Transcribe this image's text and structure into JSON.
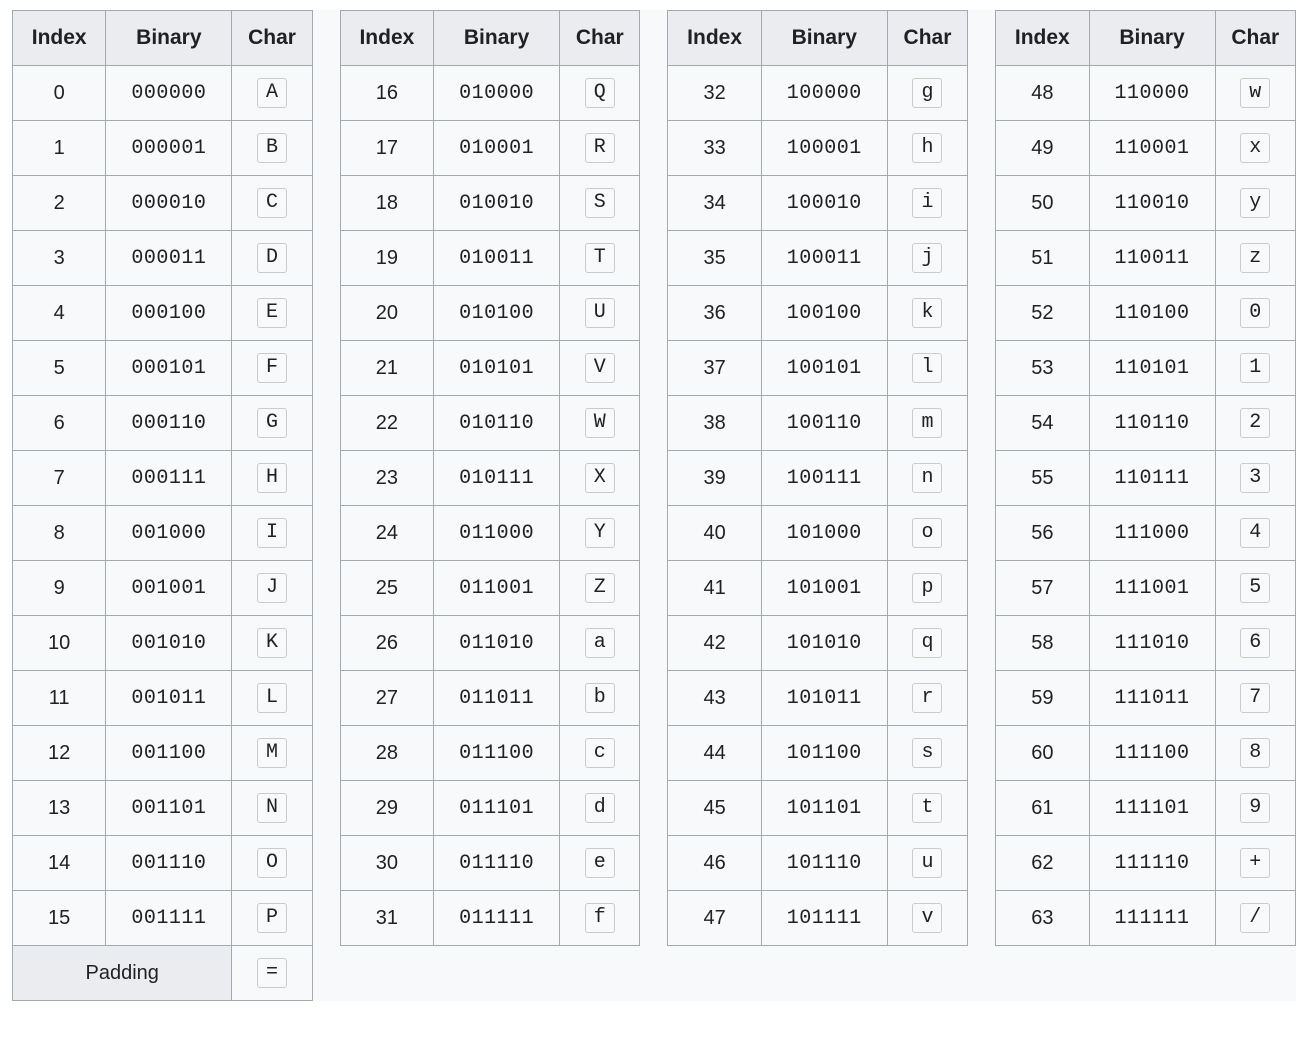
{
  "headers": {
    "index": "Index",
    "binary": "Binary",
    "char": "Char"
  },
  "columns": [
    {
      "rows": [
        {
          "index": "0",
          "binary": "000000",
          "char": "A"
        },
        {
          "index": "1",
          "binary": "000001",
          "char": "B"
        },
        {
          "index": "2",
          "binary": "000010",
          "char": "C"
        },
        {
          "index": "3",
          "binary": "000011",
          "char": "D"
        },
        {
          "index": "4",
          "binary": "000100",
          "char": "E"
        },
        {
          "index": "5",
          "binary": "000101",
          "char": "F"
        },
        {
          "index": "6",
          "binary": "000110",
          "char": "G"
        },
        {
          "index": "7",
          "binary": "000111",
          "char": "H"
        },
        {
          "index": "8",
          "binary": "001000",
          "char": "I"
        },
        {
          "index": "9",
          "binary": "001001",
          "char": "J"
        },
        {
          "index": "10",
          "binary": "001010",
          "char": "K"
        },
        {
          "index": "11",
          "binary": "001011",
          "char": "L"
        },
        {
          "index": "12",
          "binary": "001100",
          "char": "M"
        },
        {
          "index": "13",
          "binary": "001101",
          "char": "N"
        },
        {
          "index": "14",
          "binary": "001110",
          "char": "O"
        },
        {
          "index": "15",
          "binary": "001111",
          "char": "P"
        }
      ]
    },
    {
      "rows": [
        {
          "index": "16",
          "binary": "010000",
          "char": "Q"
        },
        {
          "index": "17",
          "binary": "010001",
          "char": "R"
        },
        {
          "index": "18",
          "binary": "010010",
          "char": "S"
        },
        {
          "index": "19",
          "binary": "010011",
          "char": "T"
        },
        {
          "index": "20",
          "binary": "010100",
          "char": "U"
        },
        {
          "index": "21",
          "binary": "010101",
          "char": "V"
        },
        {
          "index": "22",
          "binary": "010110",
          "char": "W"
        },
        {
          "index": "23",
          "binary": "010111",
          "char": "X"
        },
        {
          "index": "24",
          "binary": "011000",
          "char": "Y"
        },
        {
          "index": "25",
          "binary": "011001",
          "char": "Z"
        },
        {
          "index": "26",
          "binary": "011010",
          "char": "a"
        },
        {
          "index": "27",
          "binary": "011011",
          "char": "b"
        },
        {
          "index": "28",
          "binary": "011100",
          "char": "c"
        },
        {
          "index": "29",
          "binary": "011101",
          "char": "d"
        },
        {
          "index": "30",
          "binary": "011110",
          "char": "e"
        },
        {
          "index": "31",
          "binary": "011111",
          "char": "f"
        }
      ]
    },
    {
      "rows": [
        {
          "index": "32",
          "binary": "100000",
          "char": "g"
        },
        {
          "index": "33",
          "binary": "100001",
          "char": "h"
        },
        {
          "index": "34",
          "binary": "100010",
          "char": "i"
        },
        {
          "index": "35",
          "binary": "100011",
          "char": "j"
        },
        {
          "index": "36",
          "binary": "100100",
          "char": "k"
        },
        {
          "index": "37",
          "binary": "100101",
          "char": "l"
        },
        {
          "index": "38",
          "binary": "100110",
          "char": "m"
        },
        {
          "index": "39",
          "binary": "100111",
          "char": "n"
        },
        {
          "index": "40",
          "binary": "101000",
          "char": "o"
        },
        {
          "index": "41",
          "binary": "101001",
          "char": "p"
        },
        {
          "index": "42",
          "binary": "101010",
          "char": "q"
        },
        {
          "index": "43",
          "binary": "101011",
          "char": "r"
        },
        {
          "index": "44",
          "binary": "101100",
          "char": "s"
        },
        {
          "index": "45",
          "binary": "101101",
          "char": "t"
        },
        {
          "index": "46",
          "binary": "101110",
          "char": "u"
        },
        {
          "index": "47",
          "binary": "101111",
          "char": "v"
        }
      ]
    },
    {
      "rows": [
        {
          "index": "48",
          "binary": "110000",
          "char": "w"
        },
        {
          "index": "49",
          "binary": "110001",
          "char": "x"
        },
        {
          "index": "50",
          "binary": "110010",
          "char": "y"
        },
        {
          "index": "51",
          "binary": "110011",
          "char": "z"
        },
        {
          "index": "52",
          "binary": "110100",
          "char": "0"
        },
        {
          "index": "53",
          "binary": "110101",
          "char": "1"
        },
        {
          "index": "54",
          "binary": "110110",
          "char": "2"
        },
        {
          "index": "55",
          "binary": "110111",
          "char": "3"
        },
        {
          "index": "56",
          "binary": "111000",
          "char": "4"
        },
        {
          "index": "57",
          "binary": "111001",
          "char": "5"
        },
        {
          "index": "58",
          "binary": "111010",
          "char": "6"
        },
        {
          "index": "59",
          "binary": "111011",
          "char": "7"
        },
        {
          "index": "60",
          "binary": "111100",
          "char": "8"
        },
        {
          "index": "61",
          "binary": "111101",
          "char": "9"
        },
        {
          "index": "62",
          "binary": "111110",
          "char": "+"
        },
        {
          "index": "63",
          "binary": "111111",
          "char": "/"
        }
      ]
    }
  ],
  "footer": {
    "padding_label": "Padding",
    "padding_char": "="
  }
}
